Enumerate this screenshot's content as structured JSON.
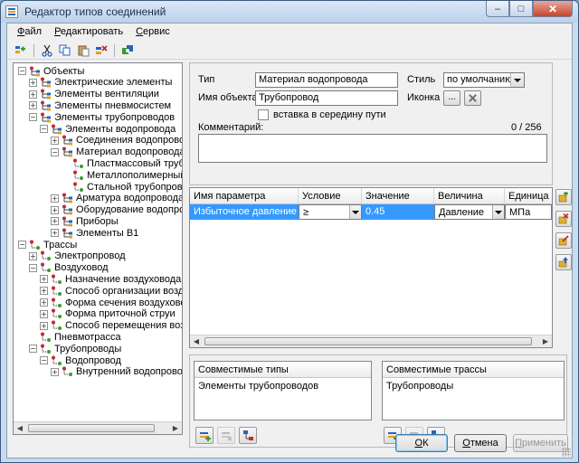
{
  "window": {
    "title": "Редактор типов соединений",
    "min": "–",
    "max": "□",
    "close": "✕"
  },
  "menu": [
    {
      "accel": "Ф",
      "rest": "айл"
    },
    {
      "accel": "Р",
      "rest": "едактировать"
    },
    {
      "accel": "С",
      "rest": "ервис"
    }
  ],
  "toolbar_icons": [
    "add-type-icon",
    "cut-icon",
    "copy-icon",
    "paste-icon",
    "delete-icon",
    "settings-icon"
  ],
  "tree": {
    "expand": "+",
    "collapse": "−",
    "nodes": [
      {
        "label": "Объекты",
        "level": 0,
        "state": "open",
        "icon": "objects"
      },
      {
        "label": "Электрические элементы",
        "level": 1,
        "state": "closed",
        "icon": "objects"
      },
      {
        "label": "Элементы вентиляции",
        "level": 1,
        "state": "closed",
        "icon": "objects"
      },
      {
        "label": "Элементы пневмосистем",
        "level": 1,
        "state": "closed",
        "icon": "objects"
      },
      {
        "label": "Элементы трубопроводов",
        "level": 1,
        "state": "open",
        "icon": "objects"
      },
      {
        "label": "Элементы водопровода",
        "level": 2,
        "state": "open",
        "icon": "objects"
      },
      {
        "label": "Соединения водопровода",
        "level": 3,
        "state": "closed",
        "icon": "objects"
      },
      {
        "label": "Материал водопровода",
        "level": 3,
        "state": "open",
        "icon": "objects"
      },
      {
        "label": "Пластмассовый трубо",
        "level": 4,
        "state": "leaf",
        "icon": "route"
      },
      {
        "label": "Металлополимерный т",
        "level": 4,
        "state": "leaf",
        "icon": "route"
      },
      {
        "label": "Стальной трубопровод",
        "level": 4,
        "state": "leaf",
        "icon": "route"
      },
      {
        "label": "Арматура водопровода",
        "level": 3,
        "state": "closed",
        "icon": "objects"
      },
      {
        "label": "Оборудование водопровод",
        "level": 3,
        "state": "closed",
        "icon": "objects"
      },
      {
        "label": "Приборы",
        "level": 3,
        "state": "closed",
        "icon": "objects"
      },
      {
        "label": "Элементы В1",
        "level": 3,
        "state": "closed",
        "icon": "objects"
      },
      {
        "label": "Трассы",
        "level": 0,
        "state": "open",
        "icon": "route"
      },
      {
        "label": "Электропровод",
        "level": 1,
        "state": "closed",
        "icon": "route"
      },
      {
        "label": "Воздуховод",
        "level": 1,
        "state": "open",
        "icon": "route"
      },
      {
        "label": "Назначение воздуховода",
        "level": 2,
        "state": "closed",
        "icon": "route"
      },
      {
        "label": "Способ организации воздухо",
        "level": 2,
        "state": "closed",
        "icon": "route"
      },
      {
        "label": "Форма сечения воздуховода",
        "level": 2,
        "state": "closed",
        "icon": "route"
      },
      {
        "label": "Форма приточной струи",
        "level": 2,
        "state": "closed",
        "icon": "route"
      },
      {
        "label": "Способ перемещения воздух",
        "level": 2,
        "state": "closed",
        "icon": "route"
      },
      {
        "label": "Пневмотрасса",
        "level": 1,
        "state": "leaf",
        "icon": "route"
      },
      {
        "label": "Трубопроводы",
        "level": 1,
        "state": "open",
        "icon": "route"
      },
      {
        "label": "Водопровод",
        "level": 2,
        "state": "open",
        "icon": "route"
      },
      {
        "label": "Внутренний водопровод",
        "level": 3,
        "state": "closed",
        "icon": "route"
      }
    ]
  },
  "props": {
    "type_label": "Тип",
    "type_value": "Материал водопровода",
    "name_label": "Имя объекта",
    "name_value": "Трубопровод",
    "style_label": "Стиль",
    "style_value": "по умолчанию",
    "icon_label": "Иконка",
    "icon_browse": "...",
    "insert_label": "вставка в середину пути",
    "insert_checked": false,
    "comment_label": "Комментарий:",
    "comment_counter": "0 / 256",
    "comment_value": ""
  },
  "params": {
    "headers": [
      "Имя параметра",
      "Условие",
      "Значение",
      "Величина",
      "Единица"
    ],
    "rows": [
      {
        "name": "Избыточное давление",
        "condition": "≥",
        "value": "0.45",
        "quantity": "Давление",
        "unit": "МПа"
      }
    ]
  },
  "compat_types": {
    "header": "Совместимые типы",
    "items": [
      "Элементы трубопроводов"
    ]
  },
  "compat_routes": {
    "header": "Совместимые трассы",
    "items": [
      "Трубопроводы"
    ]
  },
  "buttons": {
    "ok_accel": "О",
    "ok_rest": "К",
    "cancel_accel": "О",
    "cancel_rest": "тмена",
    "apply_accel": "П",
    "apply_rest": "рименить"
  },
  "colors": {
    "selection": "#3399ff",
    "accent_green": "#3c9a2e",
    "accent_red": "#c8282a"
  }
}
